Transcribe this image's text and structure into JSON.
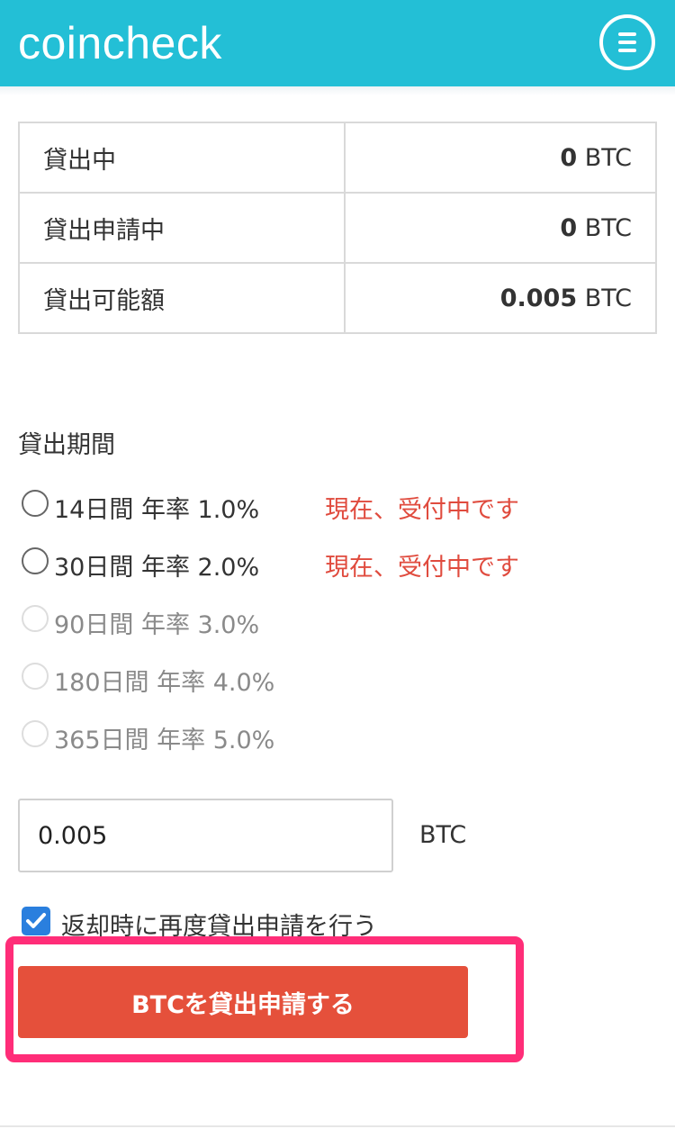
{
  "header": {
    "brand": "coincheck",
    "menu_icon": "hamburger-icon",
    "color": "#23bfd6"
  },
  "balance": {
    "rows": [
      {
        "label": "貸出中",
        "amount": "0",
        "unit": "BTC"
      },
      {
        "label": "貸出申請中",
        "amount": "0",
        "unit": "BTC"
      },
      {
        "label": "貸出可能額",
        "amount": "0.005",
        "unit": "BTC"
      }
    ]
  },
  "period": {
    "title": "貸出期間",
    "options": [
      {
        "label": "14日間 年率 1.0%",
        "status": "現在、受付中です",
        "enabled": true
      },
      {
        "label": "30日間 年率 2.0%",
        "status": "現在、受付中です",
        "enabled": true
      },
      {
        "label": "90日間 年率 3.0%",
        "status": "",
        "enabled": false
      },
      {
        "label": "180日間 年率 4.0%",
        "status": "",
        "enabled": false
      },
      {
        "label": "365日間 年率 5.0%",
        "status": "",
        "enabled": false
      }
    ]
  },
  "amount": {
    "value": "0.005",
    "unit": "BTC"
  },
  "relend": {
    "label": "返却時に再度貸出申請を行う",
    "checked": true
  },
  "submit": {
    "label": "BTCを貸出申請する",
    "color": "#e5503b"
  },
  "highlight_color": "#ff2d78"
}
